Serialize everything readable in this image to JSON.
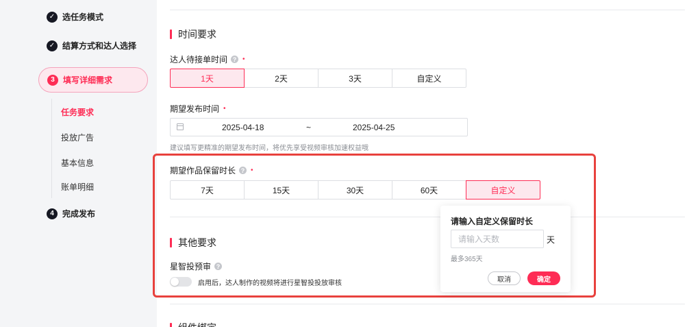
{
  "sidebar": {
    "steps": [
      {
        "num": "✓",
        "label": "选任务模式"
      },
      {
        "num": "✓",
        "label": "结算方式和达人选择"
      },
      {
        "num": "3",
        "label": "填写详细需求"
      },
      {
        "num": "4",
        "label": "完成发布"
      }
    ],
    "subnav": [
      "任务要求",
      "投放广告",
      "基本信息",
      "账单明细"
    ]
  },
  "time_section": {
    "title": "时间要求",
    "accept_label": "达人待接单时间",
    "accept_options": [
      "1天",
      "2天",
      "3天",
      "自定义"
    ],
    "publish_label": "期望发布时间",
    "date_start": "2025-04-18",
    "date_sep": "~",
    "date_end": "2025-04-25",
    "hint": "建议填写更精准的期望发布时间，将优先享受视频审核加速权益哦",
    "retain_label": "期望作品保留时长",
    "retain_options": [
      "7天",
      "15天",
      "30天",
      "60天",
      "自定义"
    ]
  },
  "other_section": {
    "title": "其他要求",
    "review_label": "星智投预审",
    "review_desc": "启用后，达人制作的视频将进行星智投投放审核",
    "review_enabled": false
  },
  "next_section": {
    "title": "组件绑定"
  },
  "popover": {
    "title": "请输入自定义保留时长",
    "placeholder": "请输入天数",
    "unit": "天",
    "max_hint": "最多365天",
    "cancel": "取消",
    "confirm": "确定"
  },
  "icons": {
    "help": "?",
    "required": "•"
  },
  "colors": {
    "accent": "#fe2c55",
    "highlight": "#e8413d"
  }
}
